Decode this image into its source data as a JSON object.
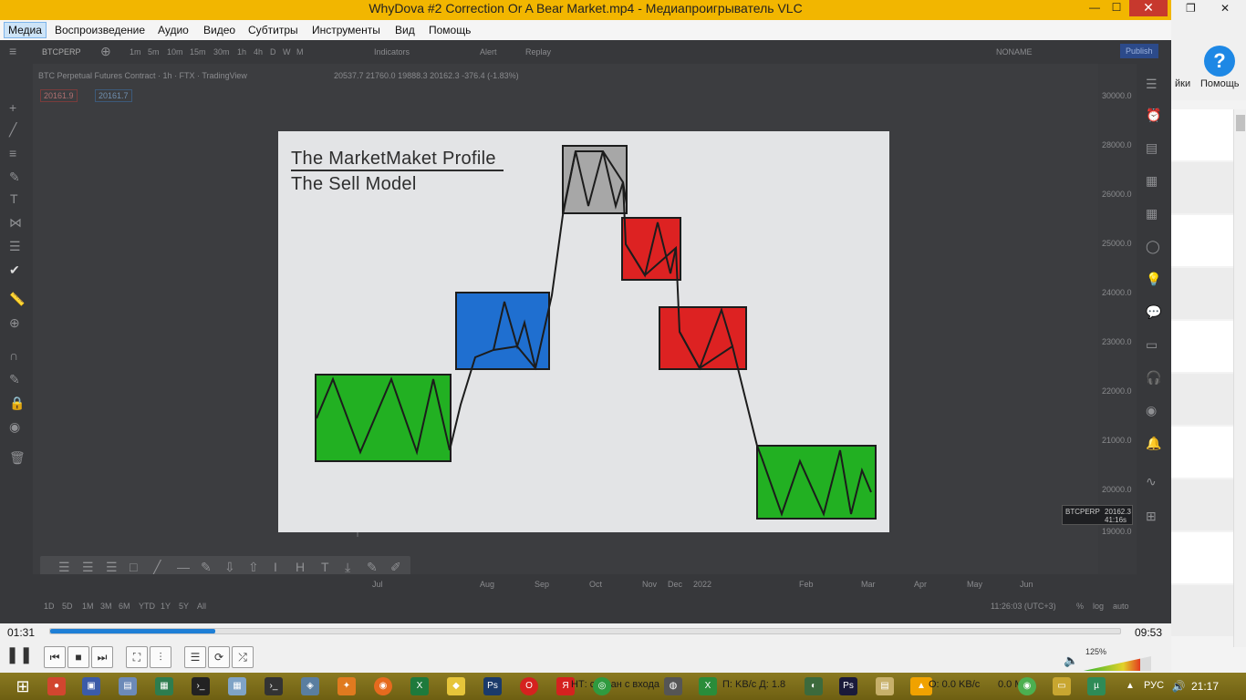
{
  "window": {
    "title": "WhyDova #2 Correction Or A Bear Market.mp4 - Медиапроигрыватель VLC",
    "min": "—",
    "max": "☐",
    "close": "✕"
  },
  "menu": {
    "items": [
      "Медиа",
      "Воспроизведение",
      "Аудио",
      "Видео",
      "Субтитры",
      "Инструменты",
      "Вид",
      "Помощь"
    ]
  },
  "background_app": {
    "help_label": "Помощь",
    "settings_label": "йки",
    "help_glyph": "?"
  },
  "video_frame": {
    "ticker": "BTCPERP",
    "intervals": [
      "1m",
      "5m",
      "10m",
      "15m",
      "30m",
      "1h",
      "4h",
      "D",
      "W",
      "M"
    ],
    "indicators_label": "Indicators",
    "alert_label": "Alert",
    "replay_label": "Replay",
    "layout_name": "NONAME",
    "publish_label": "Publish",
    "symbol_line": "BTC Perpetual Futures Contract · 1h · FTX · TradingView",
    "ohlc": "20537.7 21760.0 19888.3 20162.3 -376.4 (-1.83%)",
    "bid": "20161.9",
    "ask": "20161.7",
    "price_badge": "BTCPERP",
    "price_value": "20162.3",
    "price_time": "41:16s",
    "ranges": [
      "1D",
      "5D",
      "1M",
      "3M",
      "6M",
      "YTD",
      "1Y",
      "5Y",
      "All"
    ],
    "time_readout": "11:26:03 (UTC+3)",
    "bottom_right": [
      "%",
      "log",
      "auto"
    ],
    "price_ticks": [
      "30000.0",
      "28000.0",
      "26000.0",
      "25000.0",
      "24000.0",
      "23000.0",
      "22000.0",
      "21000.0",
      "20000.0",
      "19000.0"
    ],
    "axis_months": [
      "Jul",
      "Aug",
      "Sep",
      "Oct",
      "Nov",
      "Dec",
      "2022",
      "Feb",
      "Mar",
      "Apr",
      "May",
      "Jun"
    ]
  },
  "slide": {
    "title_line1": "The MarketMaket Profile",
    "title_line2": "The Sell Model",
    "colors": {
      "green": "#22b022",
      "blue": "#1f6fd0",
      "red": "#dd2222",
      "gray": "#a7a7a7",
      "stroke": "#1c1c1c"
    }
  },
  "player": {
    "time_elapsed": "01:31",
    "time_total": "09:53",
    "progress": 0.154,
    "volume": "125%",
    "buttons": [
      "pause-icon",
      "prev-icon",
      "stop-icon",
      "next-icon",
      "fullscreen-icon",
      "extended-settings-icon",
      "playlist-icon",
      "loop-icon",
      "random-icon"
    ]
  },
  "taskbar": {
    "items": [
      "НТ: создан с входа",
      "П: KB/с Д: 1.8",
      "О: 0.0 KB/с",
      "0.0 М"
    ],
    "lang": "РУС",
    "clock": "21:17"
  }
}
